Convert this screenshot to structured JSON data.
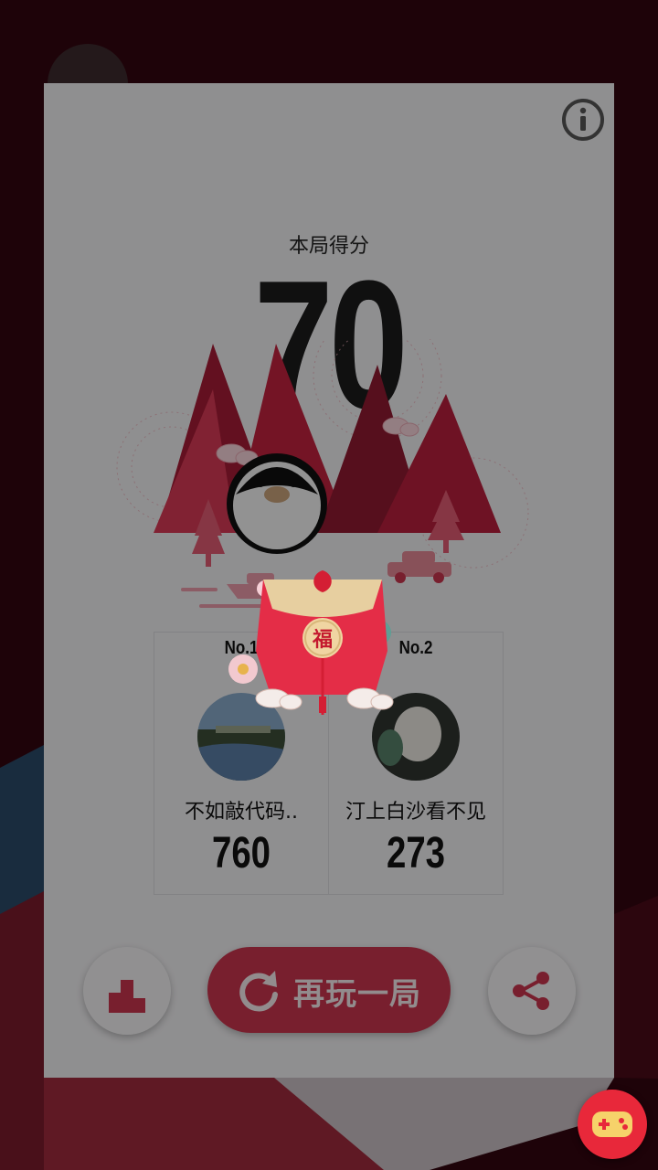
{
  "result": {
    "score_label": "本局得分",
    "score": "70"
  },
  "leaderboard": [
    {
      "rank": "No.1",
      "name": "不如敲代码..",
      "score": "760"
    },
    {
      "rank": "No.2",
      "name": "汀上白沙看不见",
      "score": "273"
    }
  ],
  "envelope": {
    "character": "福"
  },
  "actions": {
    "replay_label": "再玩一局",
    "ranking_icon": "podium-icon",
    "share_icon": "share-icon",
    "replay_icon": "replay-icon",
    "info_icon": "info-icon",
    "game_center_icon": "gamepad-icon"
  },
  "colors": {
    "accent": "#c8344e",
    "mountain": "#c2223f",
    "card": "#efeef0",
    "fab": "#e8283a"
  }
}
